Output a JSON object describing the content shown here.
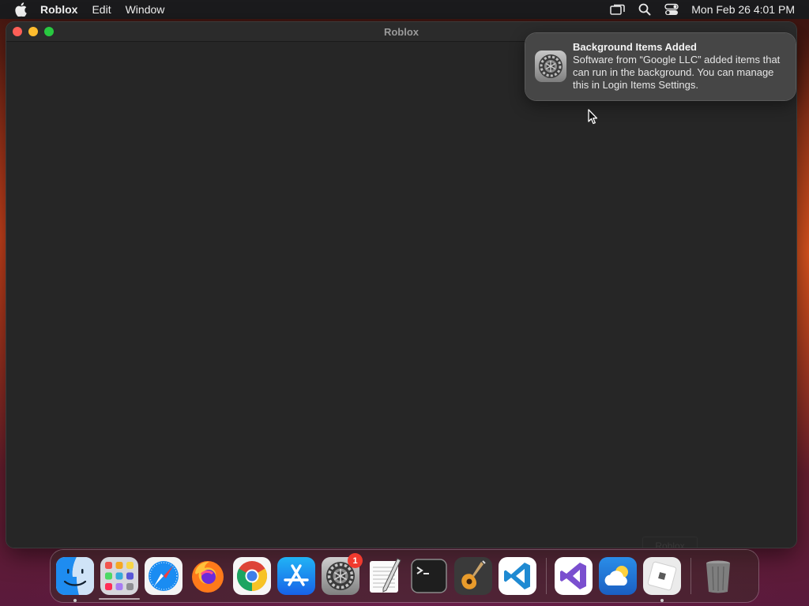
{
  "menubar": {
    "app_name": "Roblox",
    "items": [
      "Edit",
      "Window"
    ],
    "clock": "Mon Feb 26  4:01 PM"
  },
  "window": {
    "title": "Roblox",
    "faint_button_label": "Roblox"
  },
  "notification": {
    "title": "Background Items Added",
    "body": "Software from “Google LLC” added items that can run in the background. You can manage this in Login Items Settings."
  },
  "dock": {
    "items": [
      {
        "icon": "finder-icon",
        "running": true
      },
      {
        "icon": "launchpad-icon",
        "running": false
      },
      {
        "icon": "safari-icon",
        "running": false
      },
      {
        "icon": "firefox-icon",
        "running": false
      },
      {
        "icon": "chrome-icon",
        "running": false
      },
      {
        "icon": "app-store-icon",
        "running": false
      },
      {
        "icon": "system-settings-icon",
        "running": false,
        "badge": "1"
      },
      {
        "icon": "textedit-icon",
        "running": false
      },
      {
        "icon": "terminal-icon",
        "running": false
      },
      {
        "icon": "garageband-icon",
        "running": false
      },
      {
        "icon": "vscode-icon",
        "running": false
      },
      {
        "icon": "visual-studio-icon",
        "running": false
      },
      {
        "icon": "weather-icon",
        "running": false
      },
      {
        "icon": "roblox-icon",
        "running": true
      },
      {
        "icon": "trash-icon",
        "running": false
      }
    ],
    "badge_settings": "1"
  },
  "colors": {
    "menubar_bg": "#1b1b1d",
    "window_bg": "#262626",
    "notification_bg": "#484848",
    "badge_red": "#f03a2e",
    "close": "#fe5f57",
    "minimize": "#febc2e",
    "maximize": "#28c840"
  }
}
